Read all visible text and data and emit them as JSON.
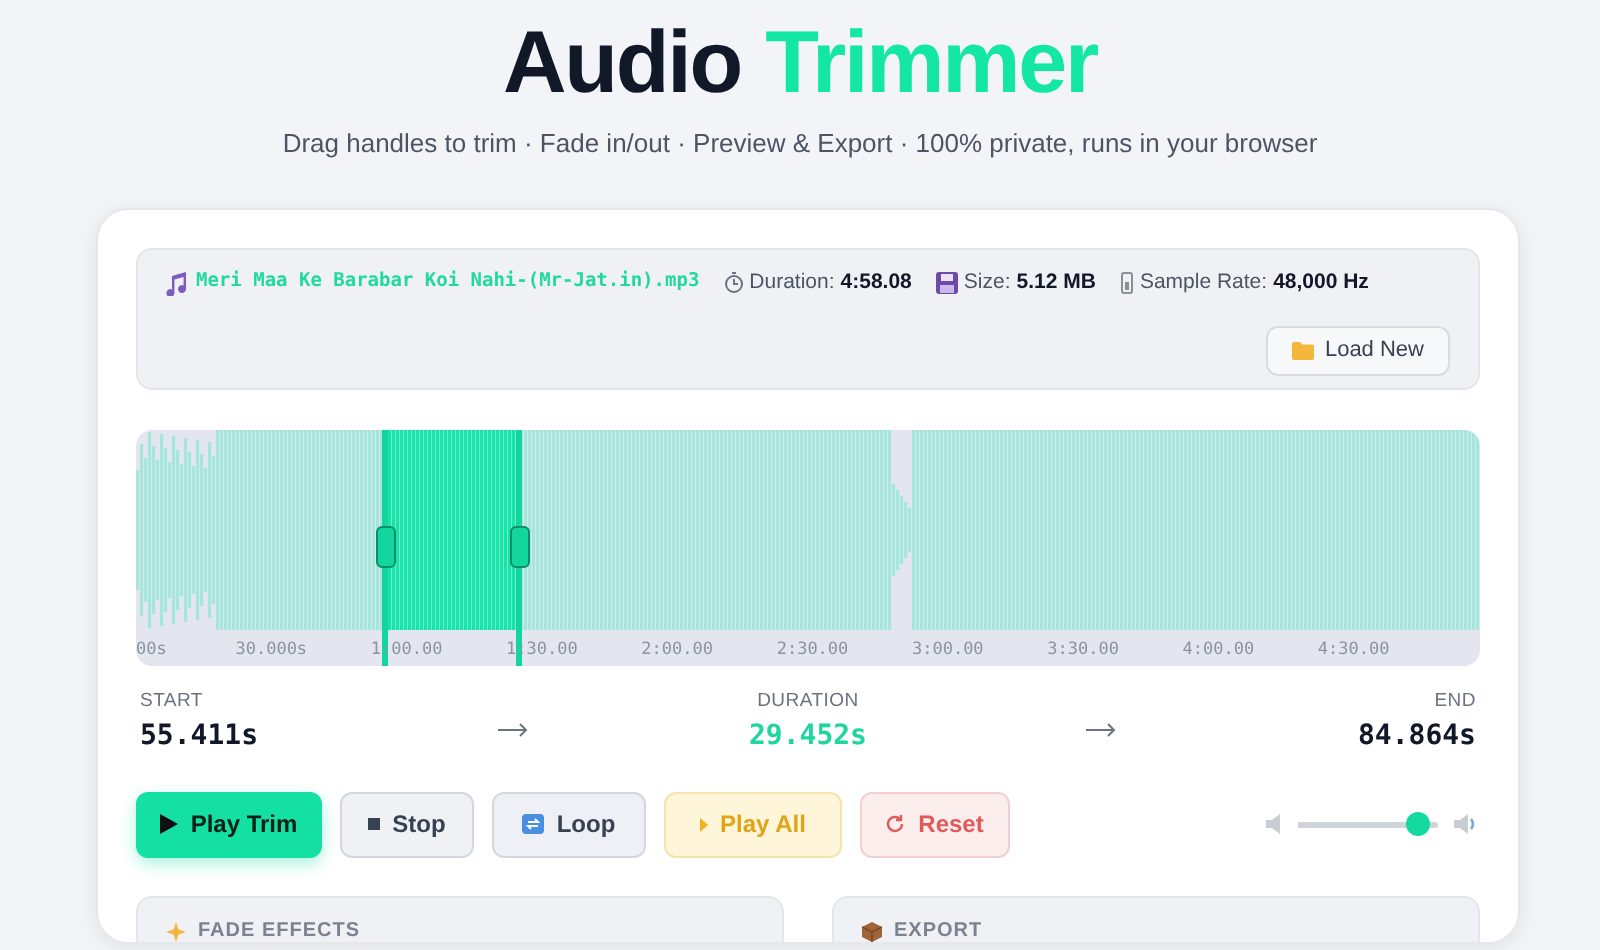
{
  "header": {
    "title_parts": [
      {
        "text": "Audio",
        "accent": false
      },
      {
        "text": "Trimmer",
        "accent": true
      }
    ],
    "subtitle": "Drag handles to trim · Fade in/out · Preview & Export · 100% private, runs in your browser"
  },
  "file_info": {
    "filename": "Meri Maa Ke Barabar Koi Nahi-(Mr-Jat.in).mp3",
    "stats": [
      {
        "kind": "clock",
        "label": "Duration:",
        "value": "4:58.08"
      },
      {
        "kind": "disk",
        "label": "Size:",
        "value": "5.12 MB"
      },
      {
        "kind": "meter",
        "label": "Sample Rate:",
        "value": "48,000 Hz"
      }
    ],
    "load_button": "Load New"
  },
  "waveform": {
    "selection_start": {
      "level": 0.186
    },
    "selection_end": {
      "level": 0.285
    },
    "time_labels": [
      "00s",
      "30.000s",
      "1:00.00",
      "1:30.00",
      "2:00.00",
      "2:30.00",
      "3:00.00",
      "3:30.00",
      "4:00.00",
      "4:30.00"
    ]
  },
  "readouts": [
    {
      "label": "START",
      "value": "55.411s",
      "accent": false
    },
    {
      "label": "DURATION",
      "value": "29.452s",
      "accent": true
    },
    {
      "label": "END",
      "value": "84.864s",
      "accent": false
    }
  ],
  "buttons": [
    {
      "kind": "play",
      "label": "Play Trim"
    },
    {
      "kind": "stop",
      "label": "Stop"
    },
    {
      "kind": "loop",
      "label": "Loop"
    },
    {
      "kind": "playall",
      "label": "Play All"
    },
    {
      "kind": "reset",
      "label": "Reset"
    }
  ],
  "volume": {
    "level": 0.85
  },
  "panels": [
    {
      "kind": "fade",
      "title": "FADE EFFECTS"
    },
    {
      "kind": "export",
      "title": "EXPORT"
    }
  ]
}
